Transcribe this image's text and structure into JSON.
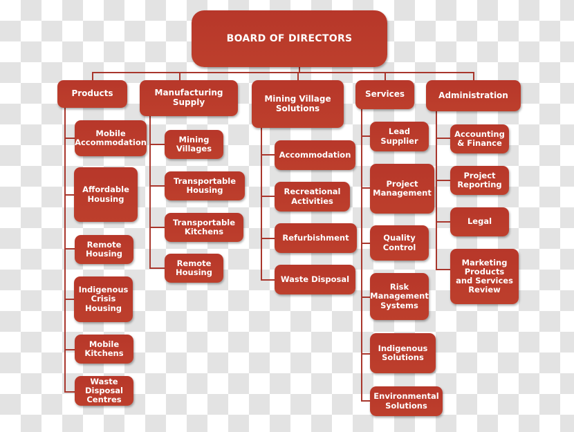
{
  "colors": {
    "box": "#b83a2a",
    "line": "#a8362c",
    "text": "#ffffff"
  },
  "root": {
    "label": "BOARD OF DIRECTORS"
  },
  "departments": [
    {
      "label": "Products",
      "children": [
        "Mobile Accommodation",
        "Affordable Housing",
        "Remote Housing",
        "Indigenous Crisis Housing",
        "Mobile Kitchens",
        "Waste Disposal Centres"
      ]
    },
    {
      "label": "Manufacturing Supply",
      "children": [
        "Mining Villages",
        "Transportable Housing",
        "Transportable Kitchens",
        "Remote Housing"
      ]
    },
    {
      "label": "Mining Village Solutions",
      "children": [
        "Accommodation",
        "Recreational Activities",
        "Refurbishment",
        "Waste Disposal"
      ]
    },
    {
      "label": "Services",
      "children": [
        "Lead Supplier",
        "Project Management",
        "Quality Control",
        "Risk Management Systems",
        "Indigenous Solutions",
        "Environmental Solutions"
      ]
    },
    {
      "label": "Administration",
      "children": [
        "Accounting & Finance",
        "Project Reporting",
        "Legal",
        "Marketing Products and Services Review"
      ]
    }
  ],
  "display": {
    "root": "BOARD OF DIRECTORS",
    "d0": "Products",
    "d1": "Manufacturing\nSupply",
    "d2": "Mining Village\nSolutions",
    "d3": "Services",
    "d4": "Administration",
    "c0": [
      "Mobile\nAccommodation",
      "Affordable\nHousing",
      "Remote\nHousing",
      "Indigenous\nCrisis\nHousing",
      "Mobile\nKitchens",
      "Waste\nDisposal\nCentres"
    ],
    "c1": [
      "Mining\nVillages",
      "Transportable\nHousing",
      "Transportable\nKitchens",
      "Remote\nHousing"
    ],
    "c2": [
      "Accommodation",
      "Recreational\nActivities",
      "Refurbishment",
      "Waste Disposal"
    ],
    "c3": [
      "Lead\nSupplier",
      "Project\nManagement",
      "Quality\nControl",
      "Risk\nManagement\nSystems",
      "Indigenous\nSolutions",
      "Environmental\nSolutions"
    ],
    "c4": [
      "Accounting\n& Finance",
      "Project\nReporting",
      "Legal",
      "Marketing\nProducts\nand Services\nReview"
    ]
  }
}
